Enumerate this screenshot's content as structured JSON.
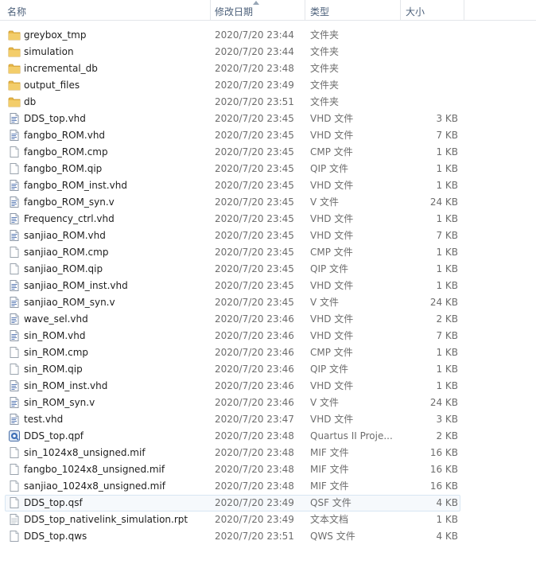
{
  "header": {
    "name_label": "名称",
    "date_label": "修改日期",
    "type_label": "类型",
    "size_label": "大小"
  },
  "colors": {
    "header_text": "#4c607a",
    "folder": "#e8b84a",
    "selected_border": "#d8e6f3"
  },
  "files": [
    {
      "name": "greybox_tmp",
      "date": "2020/7/20 23:44",
      "type": "文件夹",
      "size": "",
      "icon": "folder-icon"
    },
    {
      "name": "simulation",
      "date": "2020/7/20 23:44",
      "type": "文件夹",
      "size": "",
      "icon": "folder-icon"
    },
    {
      "name": "incremental_db",
      "date": "2020/7/20 23:48",
      "type": "文件夹",
      "size": "",
      "icon": "folder-icon"
    },
    {
      "name": "output_files",
      "date": "2020/7/20 23:49",
      "type": "文件夹",
      "size": "",
      "icon": "folder-icon"
    },
    {
      "name": "db",
      "date": "2020/7/20 23:51",
      "type": "文件夹",
      "size": "",
      "icon": "folder-icon"
    },
    {
      "name": "DDS_top.vhd",
      "date": "2020/7/20 23:45",
      "type": "VHD 文件",
      "size": "3 KB",
      "icon": "code-file-icon"
    },
    {
      "name": "fangbo_ROM.vhd",
      "date": "2020/7/20 23:45",
      "type": "VHD 文件",
      "size": "7 KB",
      "icon": "code-file-icon"
    },
    {
      "name": "fangbo_ROM.cmp",
      "date": "2020/7/20 23:45",
      "type": "CMP 文件",
      "size": "1 KB",
      "icon": "blank-file-icon"
    },
    {
      "name": "fangbo_ROM.qip",
      "date": "2020/7/20 23:45",
      "type": "QIP 文件",
      "size": "1 KB",
      "icon": "blank-file-icon"
    },
    {
      "name": "fangbo_ROM_inst.vhd",
      "date": "2020/7/20 23:45",
      "type": "VHD 文件",
      "size": "1 KB",
      "icon": "code-file-icon"
    },
    {
      "name": "fangbo_ROM_syn.v",
      "date": "2020/7/20 23:45",
      "type": "V 文件",
      "size": "24 KB",
      "icon": "code-file-icon"
    },
    {
      "name": "Frequency_ctrl.vhd",
      "date": "2020/7/20 23:45",
      "type": "VHD 文件",
      "size": "1 KB",
      "icon": "code-file-icon"
    },
    {
      "name": "sanjiao_ROM.vhd",
      "date": "2020/7/20 23:45",
      "type": "VHD 文件",
      "size": "7 KB",
      "icon": "code-file-icon"
    },
    {
      "name": "sanjiao_ROM.cmp",
      "date": "2020/7/20 23:45",
      "type": "CMP 文件",
      "size": "1 KB",
      "icon": "blank-file-icon"
    },
    {
      "name": "sanjiao_ROM.qip",
      "date": "2020/7/20 23:45",
      "type": "QIP 文件",
      "size": "1 KB",
      "icon": "blank-file-icon"
    },
    {
      "name": "sanjiao_ROM_inst.vhd",
      "date": "2020/7/20 23:45",
      "type": "VHD 文件",
      "size": "1 KB",
      "icon": "code-file-icon"
    },
    {
      "name": "sanjiao_ROM_syn.v",
      "date": "2020/7/20 23:45",
      "type": "V 文件",
      "size": "24 KB",
      "icon": "code-file-icon"
    },
    {
      "name": "wave_sel.vhd",
      "date": "2020/7/20 23:46",
      "type": "VHD 文件",
      "size": "2 KB",
      "icon": "code-file-icon"
    },
    {
      "name": "sin_ROM.vhd",
      "date": "2020/7/20 23:46",
      "type": "VHD 文件",
      "size": "7 KB",
      "icon": "code-file-icon"
    },
    {
      "name": "sin_ROM.cmp",
      "date": "2020/7/20 23:46",
      "type": "CMP 文件",
      "size": "1 KB",
      "icon": "blank-file-icon"
    },
    {
      "name": "sin_ROM.qip",
      "date": "2020/7/20 23:46",
      "type": "QIP 文件",
      "size": "1 KB",
      "icon": "blank-file-icon"
    },
    {
      "name": "sin_ROM_inst.vhd",
      "date": "2020/7/20 23:46",
      "type": "VHD 文件",
      "size": "1 KB",
      "icon": "code-file-icon"
    },
    {
      "name": "sin_ROM_syn.v",
      "date": "2020/7/20 23:46",
      "type": "V 文件",
      "size": "24 KB",
      "icon": "code-file-icon"
    },
    {
      "name": "test.vhd",
      "date": "2020/7/20 23:47",
      "type": "VHD 文件",
      "size": "3 KB",
      "icon": "code-file-icon"
    },
    {
      "name": "DDS_top.qpf",
      "date": "2020/7/20 23:48",
      "type": "Quartus II Proje...",
      "size": "2 KB",
      "icon": "quartus-project-icon"
    },
    {
      "name": "sin_1024x8_unsigned.mif",
      "date": "2020/7/20 23:48",
      "type": "MIF 文件",
      "size": "16 KB",
      "icon": "blank-file-icon"
    },
    {
      "name": "fangbo_1024x8_unsigned.mif",
      "date": "2020/7/20 23:48",
      "type": "MIF 文件",
      "size": "16 KB",
      "icon": "blank-file-icon"
    },
    {
      "name": "sanjiao_1024x8_unsigned.mif",
      "date": "2020/7/20 23:48",
      "type": "MIF 文件",
      "size": "16 KB",
      "icon": "blank-file-icon"
    },
    {
      "name": "DDS_top.qsf",
      "date": "2020/7/20 23:49",
      "type": "QSF 文件",
      "size": "4 KB",
      "icon": "blank-file-icon",
      "selected": true
    },
    {
      "name": "DDS_top_nativelink_simulation.rpt",
      "date": "2020/7/20 23:49",
      "type": "文本文档",
      "size": "1 KB",
      "icon": "text-file-icon"
    },
    {
      "name": "DDS_top.qws",
      "date": "2020/7/20 23:51",
      "type": "QWS 文件",
      "size": "4 KB",
      "icon": "blank-file-icon"
    }
  ]
}
